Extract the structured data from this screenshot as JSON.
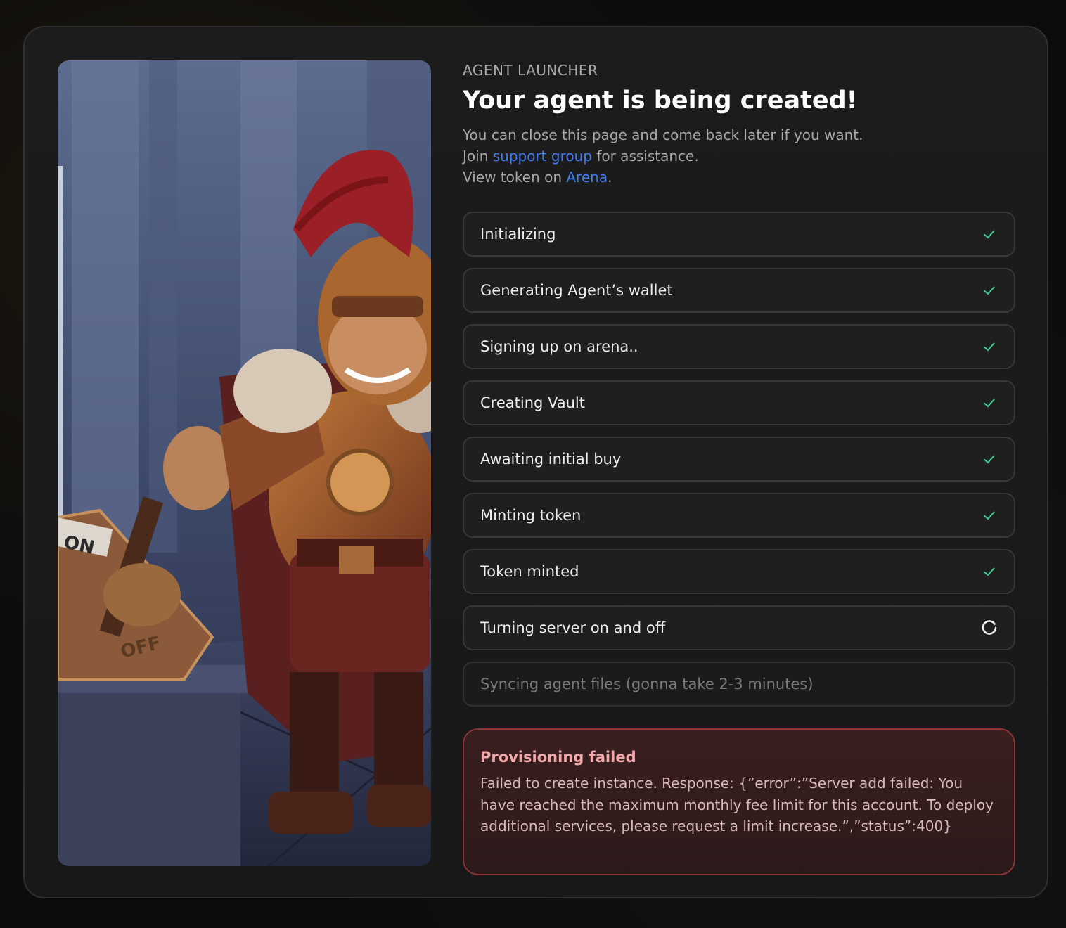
{
  "header": {
    "eyebrow": "AGENT LAUNCHER",
    "title": "Your agent is being created!",
    "line1": "You can close this page and come back later if you want.",
    "line2_prefix": "Join ",
    "line2_link": "support group",
    "line2_suffix": " for assistance.",
    "line3_prefix": "View token on ",
    "line3_link": "Arena",
    "line3_suffix": "."
  },
  "steps": [
    {
      "label": "Initializing",
      "status": "done"
    },
    {
      "label": "Generating Agent’s wallet",
      "status": "done"
    },
    {
      "label": "Signing up on arena..",
      "status": "done"
    },
    {
      "label": "Creating Vault",
      "status": "done"
    },
    {
      "label": "Awaiting initial buy",
      "status": "done"
    },
    {
      "label": "Minting token",
      "status": "done"
    },
    {
      "label": "Token minted",
      "status": "done"
    },
    {
      "label": "Turning server on and off",
      "status": "in-progress"
    },
    {
      "label": "Syncing agent files (gonna take 2-3 minutes)",
      "status": "pending"
    }
  ],
  "error": {
    "title": "Provisioning failed",
    "message": "Failed to create instance. Response: {”error”:”Server add failed: You have reached the maximum monthly fee limit for this account. To deploy additional services, please request a limit increase.”,”status”:400}"
  },
  "hero": {
    "switch_on_label": "ON",
    "switch_off_label": "OFF"
  },
  "colors": {
    "check": "#3ecf8e",
    "link": "#3f7cf0",
    "error_border": "#8a3434"
  },
  "icons": {
    "done": "check-icon",
    "in-progress": "spinner-icon"
  }
}
